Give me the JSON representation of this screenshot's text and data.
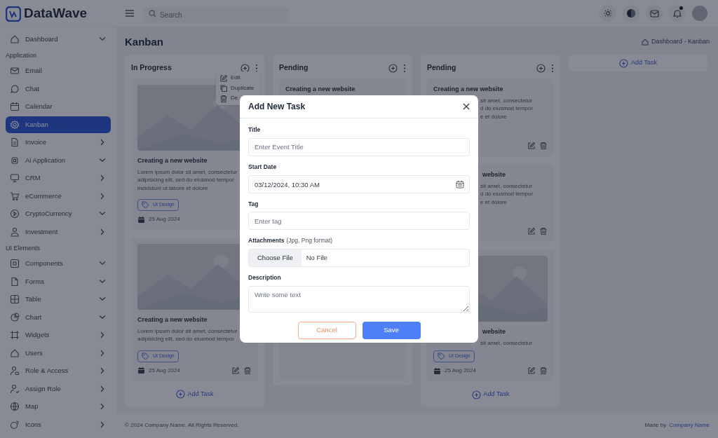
{
  "brand": "DataWave",
  "sidebar": {
    "items": [
      {
        "kind": "dropdown",
        "label": "Dashboard",
        "selected": false
      },
      {
        "kind": "section",
        "label": "Application"
      },
      {
        "kind": "item",
        "label": "Email",
        "selected": false
      },
      {
        "kind": "item",
        "label": "Chat",
        "selected": false
      },
      {
        "kind": "item",
        "label": "Calendar",
        "selected": false
      },
      {
        "kind": "item",
        "label": "Kanban",
        "selected": true
      },
      {
        "kind": "link",
        "label": "Invoice",
        "selected": false
      },
      {
        "kind": "dropdown",
        "label": "Ai Application",
        "selected": false
      },
      {
        "kind": "link",
        "label": "CRM",
        "selected": false
      },
      {
        "kind": "link",
        "label": "eCommerce",
        "selected": false
      },
      {
        "kind": "dropdown",
        "label": "CryptoCurrency",
        "selected": false
      },
      {
        "kind": "link",
        "label": "Investment",
        "selected": false
      },
      {
        "kind": "section",
        "label": "UI Elements"
      },
      {
        "kind": "dropdown",
        "label": "Components",
        "selected": false
      },
      {
        "kind": "dropdown",
        "label": "Forms",
        "selected": false
      },
      {
        "kind": "dropdown",
        "label": "Table",
        "selected": false
      },
      {
        "kind": "dropdown",
        "label": "Chart",
        "selected": false
      },
      {
        "kind": "link",
        "label": "Widgets",
        "selected": false
      },
      {
        "kind": "link",
        "label": "Users",
        "selected": false
      },
      {
        "kind": "link",
        "label": "Role & Access",
        "selected": false
      },
      {
        "kind": "link",
        "label": "Assign Role",
        "selected": false
      },
      {
        "kind": "link",
        "label": "Map",
        "selected": false
      },
      {
        "kind": "link",
        "label": "Icons",
        "selected": false
      }
    ]
  },
  "topbar": {
    "search": {
      "placeholder": "Search"
    },
    "notification_dot": true
  },
  "page": {
    "title": "Kanban",
    "breadcrumb": "Dashboard - Kanban"
  },
  "columns": [
    {
      "title": "In Progress",
      "menu": [
        "Edit",
        "Duplicate",
        "De"
      ],
      "cards": [
        {
          "picture": true,
          "title": "Creating a new website",
          "description": "Lorem ipsum dolor sit amet, consectetur adipisicing elit, sed do eiusmod tempor incididunt ut labore et dolore",
          "tag": "UI Design",
          "date": "25 Aug 2024",
          "actions": false
        },
        {
          "picture": true,
          "title": "Creating a new website",
          "description": "Lorem ipsum dolor sit amet, consectetur adipisicing elit, sed do eiusmod tempor",
          "tag": "UI Design",
          "date": "25 Aug 2024",
          "actions": true
        }
      ],
      "add": "Add Task"
    },
    {
      "title": "Pending",
      "cards": [
        {
          "title": "Creating a new website"
        }
      ]
    },
    {
      "title": "Pending",
      "cards": [
        {
          "title": "Creating a new website",
          "fragments": [
            "sit amet, consectetur",
            "d do eiusmod tempor",
            "e et dolore"
          ],
          "actions": true
        },
        {
          "title_fragment": "website",
          "fragments": [
            "sit amet, consectetur",
            "d do eiusmod tempor",
            "e et dolore"
          ],
          "actions": true
        },
        {
          "picture": true,
          "title_fragment": "website",
          "fragments": [
            "sit amet, consectetur"
          ],
          "tag": "UI Design",
          "date": "25 Aug 2024",
          "actions": true
        }
      ],
      "add": "Add Task"
    },
    {
      "kind": "add",
      "add": "Add Task"
    }
  ],
  "footer": {
    "copyright": "© 2024 Company Name. All Rights Reserved.",
    "made_by": "Made by",
    "made_by_link": "Company Name"
  },
  "modal": {
    "title": "Add New Task",
    "fields": [
      {
        "kind": "text",
        "label": "Title",
        "placeholder": "Enter Event Title"
      },
      {
        "kind": "date",
        "label": "Start Date",
        "value": "03/12/2024, 10:30 AM"
      },
      {
        "kind": "text",
        "label": "Tag",
        "placeholder": "Enter tag"
      },
      {
        "kind": "file",
        "label": "Attachments",
        "hint": "(Jpg, Png format)",
        "button": "Choose File",
        "value": "No File"
      },
      {
        "kind": "textarea",
        "label": "Description",
        "placeholder": "Write some text"
      }
    ],
    "buttons": [
      {
        "kind": "secondary",
        "label": "Cancel"
      },
      {
        "kind": "primary",
        "label": "Save"
      }
    ]
  }
}
